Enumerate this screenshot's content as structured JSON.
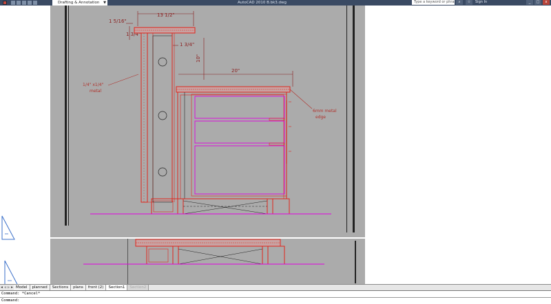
{
  "titlebar": {
    "workspace": "Drafting & Annotation",
    "title": "AutoCAD 2010    B.bk3.dwg",
    "search_placeholder": "Type a keyword or phrase",
    "sign_in": "Sign In",
    "win_min": "_",
    "win_max": "□",
    "win_close": "x",
    "search_glyph": "⌕",
    "star_glyph": "☆"
  },
  "drawing": {
    "dim_top_width": "13 1/2\"",
    "dim_thickness": "1 5/16\"",
    "dim_inner_1": "1 3/4\"",
    "dim_inner_2": "1 3/4\"",
    "dim_vertical": "10\"",
    "dim_counter": "20\"",
    "note_left": "1/4\" x1/4\"",
    "note_left_2": "metal",
    "note_right": "6mm metal",
    "note_right_2": "edge"
  },
  "tabs": {
    "items": [
      {
        "label": "Model",
        "state": "normal"
      },
      {
        "label": "planned",
        "state": "normal"
      },
      {
        "label": "Sections",
        "state": "normal"
      },
      {
        "label": "plans",
        "state": "normal"
      },
      {
        "label": "front (2)",
        "state": "normal"
      },
      {
        "label": "Section1",
        "state": "active"
      },
      {
        "label": "Section2",
        "state": "disabled"
      }
    ]
  },
  "command": {
    "history": "Command: *Cancel*",
    "prompt": "Command:"
  },
  "colors": {
    "background_drawing": "#ababab",
    "line_red": "#e0241b",
    "line_magenta": "#e000e0",
    "titlebar": "#3a4a63"
  }
}
